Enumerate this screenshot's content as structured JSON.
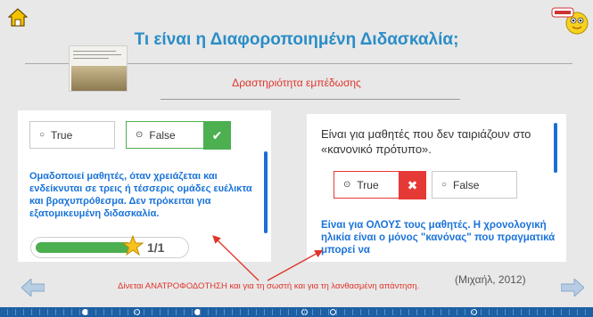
{
  "header": {
    "title": "Τι είναι η Διαφοροποιημένη Διδασκαλία;",
    "subtitle": "Δραστηριότητα εμπέδωσης"
  },
  "left_card": {
    "option_true": "True",
    "option_false": "False",
    "selected": "False",
    "result": "correct",
    "feedback": "Ομαδοποιεί μαθητές, όταν χρειάζεται και ενδείκνυται σε τρεις ή τέσσερις ομάδες ευέλικτα και βραχυπρόθεσμα. Δεν πρόκειται για εξατομικευμένη διδασκαλία.",
    "score": "1/1",
    "progress": 1.0
  },
  "right_card": {
    "question": "Είναι για μαθητές που δεν ταιριάζουν στο «κανονικό πρότυπο».",
    "option_true": "True",
    "option_false": "False",
    "selected": "True",
    "result": "wrong",
    "feedback": "Είναι για ΟΛΟΥΣ τους μαθητές. Η χρονολογική ηλικία είναι ο μόνος \"κανόνας\" που πραγματικά μπορεί να"
  },
  "annotation_note": "Δίνεται ΑΝΑΤΡΟΦΟΔΟΤΗΣΗ και για τη σωστή και για τη λανθασμένη απάντηση.",
  "citation": "(Μιχαήλ, 2012)",
  "colors": {
    "title": "#2a8dc7",
    "accent_red": "#e0342b",
    "feedback_blue": "#1a73d9",
    "correct_green": "#4caf50",
    "wrong_red": "#e53935",
    "timeline": "#1d5fa3"
  }
}
